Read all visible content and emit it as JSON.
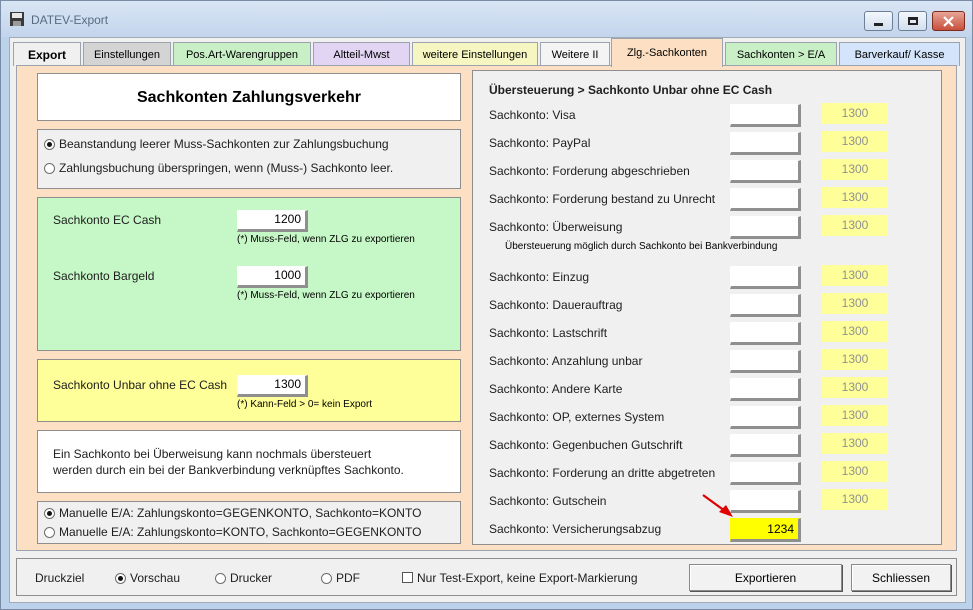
{
  "window": {
    "title": "DATEV-Export",
    "minimize_icon": "minimize-icon",
    "maximize_icon": "maximize-icon",
    "close_icon": "close-icon"
  },
  "tabs": [
    {
      "label": "Export",
      "color": "#f0f0f0",
      "active": false
    },
    {
      "label": "Einstellungen",
      "color": "#d4d4d4",
      "active": false
    },
    {
      "label": "Pos.Art-Warengruppen",
      "color": "#c9efc6",
      "active": false
    },
    {
      "label": "Altteil-Mwst",
      "color": "#e2d5f3",
      "active": false
    },
    {
      "label": "weitere Einstellungen",
      "color": "#f6f6c2",
      "active": false
    },
    {
      "label": "Weitere II",
      "color": "#f4f4f4",
      "active": false
    },
    {
      "label": "Zlg.-Sachkonten",
      "color": "#fde0c3",
      "active": true
    },
    {
      "label": "Sachkonten > E/A",
      "color": "#c9efc6",
      "active": false
    },
    {
      "label": "Barverkauf/ Kasse",
      "color": "#d4e4fa",
      "active": false
    }
  ],
  "left": {
    "heading": "Sachkonten Zahlungsverkehr",
    "validation_options": [
      {
        "label": "Beanstandung leerer Muss-Sachkonten zur Zahlungsbuchung",
        "checked": true
      },
      {
        "label": "Zahlungsbuchung überspringen, wenn (Muss-) Sachkonto leer.",
        "checked": false
      }
    ],
    "ec_cash": {
      "label": "Sachkonto EC Cash",
      "value": "1200",
      "hint": "(*) Muss-Feld, wenn ZLG zu exportieren"
    },
    "bargeld": {
      "label": "Sachkonto Bargeld",
      "value": "1000",
      "hint": "(*) Muss-Feld, wenn ZLG zu exportieren"
    },
    "unbar": {
      "label": "Sachkonto Unbar ohne EC Cash",
      "value": "1300",
      "hint": "(*) Kann-Feld > 0= kein Export"
    },
    "info_line1": "Ein Sachkonto bei Überweisung kann nochmals übersteuert",
    "info_line2": "werden durch ein bei der Bankverbindung verknüpftes Sachkonto.",
    "ea_options": [
      {
        "label": "Manuelle E/A: Zahlungskonto=GEGENKONTO, Sachkonto=KONTO",
        "checked": true
      },
      {
        "label": "Manuelle E/A: Zahlungskonto=KONTO, Sachkonto=GEGENKONTO",
        "checked": false
      }
    ]
  },
  "right": {
    "heading": "Übersteuerung > Sachkonto Unbar ohne EC Cash",
    "rows_a": [
      {
        "label": "Sachkonto: Visa",
        "value": "",
        "default": "1300"
      },
      {
        "label": "Sachkonto: PayPal",
        "value": "",
        "default": "1300"
      },
      {
        "label": "Sachkonto: Forderung abgeschrieben",
        "value": "",
        "default": "1300"
      },
      {
        "label": "Sachkonto: Forderung bestand zu Unrecht",
        "value": "",
        "default": "1300"
      },
      {
        "label": "Sachkonto: Überweisung",
        "value": "",
        "default": "1300"
      }
    ],
    "note": "Übersteuerung möglich durch Sachkonto bei Bankverbindung",
    "rows_b": [
      {
        "label": "Sachkonto: Einzug",
        "value": "",
        "default": "1300"
      },
      {
        "label": "Sachkonto: Dauerauftrag",
        "value": "",
        "default": "1300"
      },
      {
        "label": "Sachkonto: Lastschrift",
        "value": "",
        "default": "1300"
      },
      {
        "label": "Sachkonto: Anzahlung unbar",
        "value": "",
        "default": "1300"
      },
      {
        "label": "Sachkonto: Andere Karte",
        "value": "",
        "default": "1300"
      },
      {
        "label": "Sachkonto: OP, externes System",
        "value": "",
        "default": "1300"
      },
      {
        "label": "Sachkonto: Gegenbuchen Gutschrift",
        "value": "",
        "default": "1300"
      },
      {
        "label": "Sachkonto: Forderung an dritte abgetreten",
        "value": "",
        "default": "1300"
      },
      {
        "label": "Sachkonto: Gutschein",
        "value": "",
        "default": "1300"
      }
    ],
    "versicherung": {
      "label": "Sachkonto: Versicherungsabzug",
      "value": "1234"
    }
  },
  "bottom": {
    "druckziel_label": "Druckziel",
    "targets": [
      {
        "label": "Vorschau",
        "checked": true
      },
      {
        "label": "Drucker",
        "checked": false
      },
      {
        "label": "PDF",
        "checked": false
      }
    ],
    "test_export_label": "Nur Test-Export, keine Export-Markierung",
    "export_button": "Exportieren",
    "close_button": "Schliessen"
  },
  "colors": {
    "panel": "#fde0c3",
    "green_box": "#c6f7c6",
    "yellow_box": "#ffff99",
    "highlight_field": "#ffff00",
    "arrow": "#e00000"
  }
}
